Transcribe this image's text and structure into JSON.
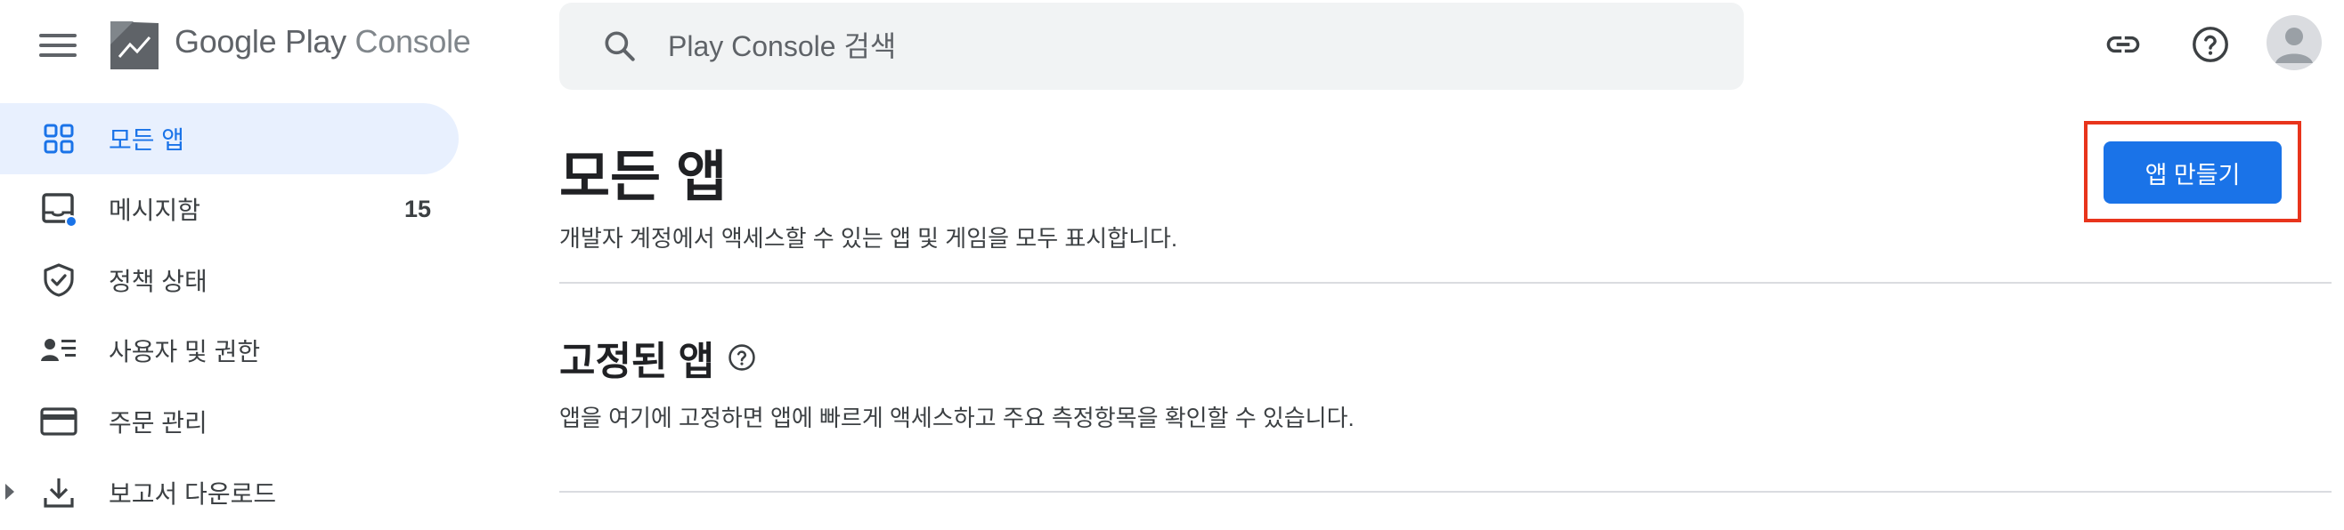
{
  "header": {
    "logo_main": "Google Play",
    "logo_sub": "Console",
    "search_placeholder": "Play Console 검색"
  },
  "sidebar": {
    "items": [
      {
        "label": "모든 앱",
        "icon": "apps-grid-icon",
        "active": true
      },
      {
        "label": "메시지함",
        "icon": "inbox-icon",
        "count": "15"
      },
      {
        "label": "정책 상태",
        "icon": "shield-check-icon"
      },
      {
        "label": "사용자 및 권한",
        "icon": "users-list-icon"
      },
      {
        "label": "주문 관리",
        "icon": "credit-card-icon"
      },
      {
        "label": "보고서 다운로드",
        "icon": "download-icon",
        "expandable": true
      }
    ]
  },
  "main": {
    "title": "모든 앱",
    "subtitle": "개발자 계정에서 액세스할 수 있는 앱 및 게임을 모두 표시합니다.",
    "create_button": "앱 만들기",
    "pinned": {
      "title": "고정된 앱",
      "description": "앱을 여기에 고정하면 앱에 빠르게 액세스하고 주요 측정항목을 확인할 수 있습니다."
    }
  },
  "colors": {
    "accent": "#1a73e8",
    "active_nav_bg": "#e8f0fe",
    "highlight_frame": "#e8341c"
  }
}
